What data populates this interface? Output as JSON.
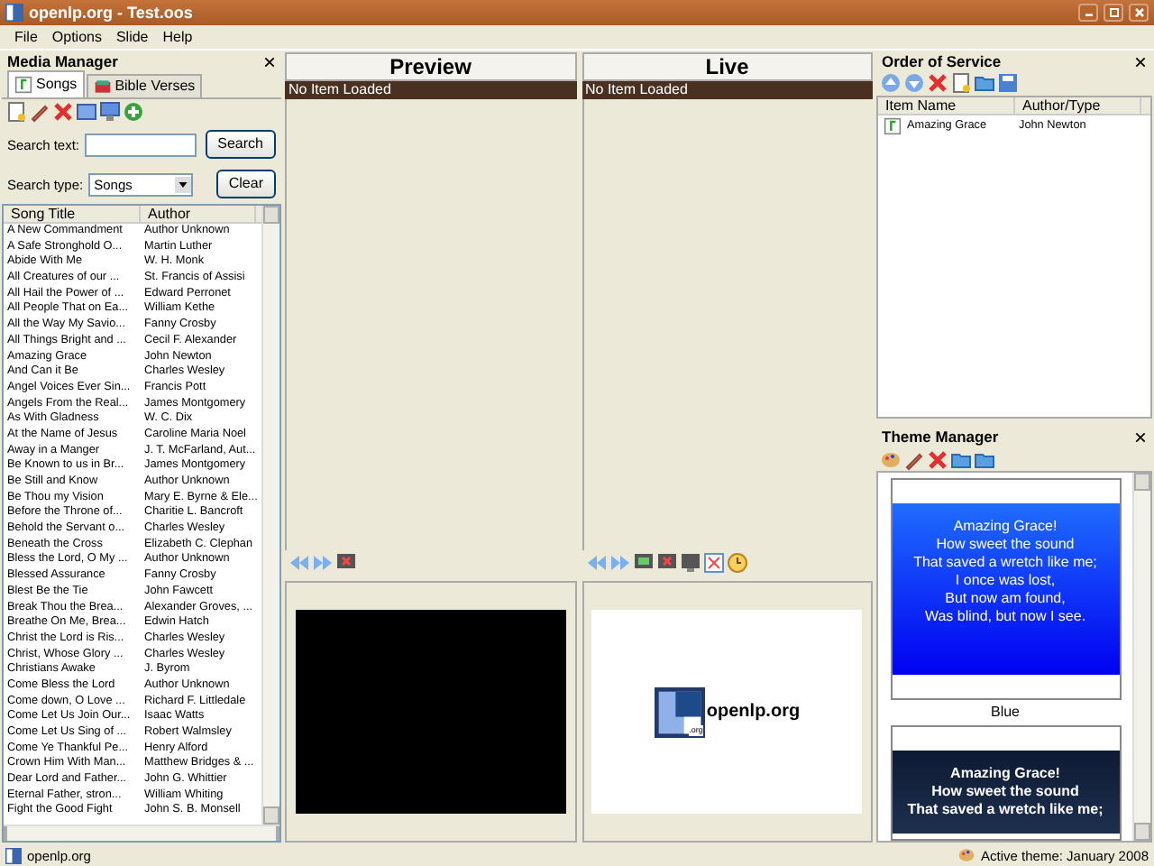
{
  "window": {
    "title": "openlp.org - Test.oos"
  },
  "menu": [
    "File",
    "Options",
    "Slide",
    "Help"
  ],
  "media_manager": {
    "title": "Media Manager",
    "tabs": [
      {
        "label": "Songs",
        "selected": true
      },
      {
        "label": "Bible Verses",
        "selected": false
      }
    ],
    "search_label": "Search text:",
    "search_button": "Search",
    "search_type_label": "Search type:",
    "search_type": "Songs",
    "clear_button": "Clear",
    "columns": [
      "Song Title",
      "Author"
    ],
    "rows": [
      [
        "A New Commandment",
        "Author Unknown"
      ],
      [
        "A Safe Stronghold O...",
        "Martin Luther"
      ],
      [
        "Abide With Me",
        "W. H. Monk"
      ],
      [
        "All Creatures of our ...",
        "St. Francis of Assisi"
      ],
      [
        "All Hail the Power of ...",
        "Edward Perronet"
      ],
      [
        "All People That on Ea...",
        "William Kethe"
      ],
      [
        "All the Way My Savio...",
        "Fanny Crosby"
      ],
      [
        "All Things Bright and ...",
        "Cecil F. Alexander"
      ],
      [
        "Amazing Grace",
        "John Newton"
      ],
      [
        "And Can it Be",
        "Charles Wesley"
      ],
      [
        "Angel Voices Ever Sin...",
        "Francis Pott"
      ],
      [
        "Angels From the Real...",
        "James Montgomery"
      ],
      [
        "As With Gladness",
        "W. C. Dix"
      ],
      [
        "At the Name of Jesus",
        "Caroline Maria Noel"
      ],
      [
        "Away in a Manger",
        "J. T. McFarland, Aut..."
      ],
      [
        "Be Known to us in Br...",
        "James Montgomery"
      ],
      [
        "Be Still and Know",
        "Author Unknown"
      ],
      [
        "Be Thou my Vision",
        "Mary E. Byrne & Ele..."
      ],
      [
        "Before the Throne of...",
        "Charitie L. Bancroft"
      ],
      [
        "Behold the Servant o...",
        "Charles Wesley"
      ],
      [
        "Beneath the Cross",
        "Elizabeth C. Clephan"
      ],
      [
        "Bless the Lord, O My ...",
        "Author Unknown"
      ],
      [
        "Blessed Assurance",
        "Fanny Crosby"
      ],
      [
        "Blest Be the Tie",
        "John Fawcett"
      ],
      [
        "Break Thou the Brea...",
        "Alexander Groves, ..."
      ],
      [
        "Breathe On Me, Brea...",
        "Edwin Hatch"
      ],
      [
        "Christ the Lord is Ris...",
        "Charles Wesley"
      ],
      [
        "Christ, Whose Glory ...",
        "Charles Wesley"
      ],
      [
        "Christians Awake",
        "J. Byrom"
      ],
      [
        "Come Bless the Lord",
        "Author Unknown"
      ],
      [
        "Come down, O Love ...",
        "Richard F. Littledale"
      ],
      [
        "Come Let Us Join Our...",
        "Isaac Watts"
      ],
      [
        "Come Let Us Sing of ...",
        "Robert Walmsley"
      ],
      [
        "Come Ye Thankful Pe...",
        "Henry Alford"
      ],
      [
        "Crown Him With Man...",
        "Matthew Bridges & ..."
      ],
      [
        "Dear Lord and Father...",
        "John G. Whittier"
      ],
      [
        "Eternal Father, stron...",
        "William Whiting"
      ],
      [
        "Fight the Good Fight",
        "John S. B. Monsell"
      ]
    ]
  },
  "preview": {
    "title": "Preview",
    "status": "No Item Loaded"
  },
  "live": {
    "title": "Live",
    "status": "No Item Loaded",
    "logo_text": "openlp.org",
    "logo_badge": ".org"
  },
  "order_of_service": {
    "title": "Order of Service",
    "columns": [
      "Item Name",
      "Author/Type"
    ],
    "items": [
      {
        "name": "Amazing Grace",
        "author": "John Newton"
      }
    ]
  },
  "theme_manager": {
    "title": "Theme Manager",
    "themes": [
      {
        "kind": "blue",
        "name": "Blue",
        "lines": [
          "Amazing Grace!",
          "How sweet the sound",
          "That saved a wretch like me;",
          "I once was lost,",
          "But now am found,",
          "Was blind, but now I see."
        ]
      },
      {
        "kind": "dark",
        "lines": [
          "Amazing Grace!",
          "How sweet the sound",
          "That saved a wretch like me;"
        ]
      }
    ]
  },
  "status_bar": {
    "left": "openlp.org",
    "right": "Active theme: January 2008"
  }
}
